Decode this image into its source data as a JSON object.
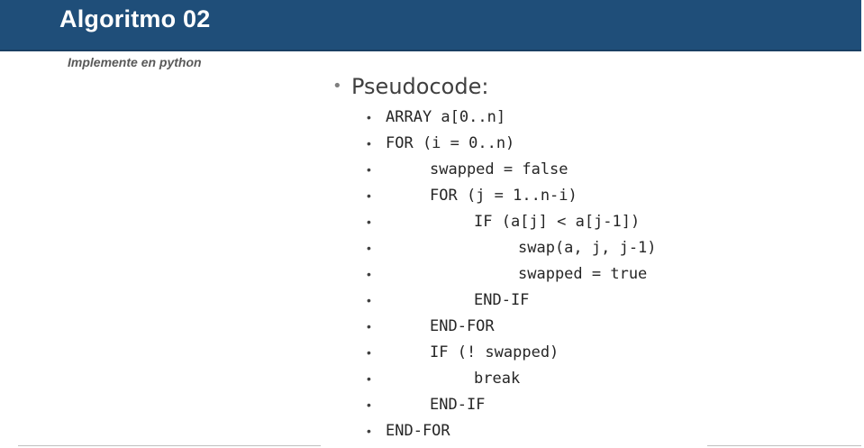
{
  "title": "Algoritmo 02",
  "subtitle": "Implemente en python",
  "pseudocode": {
    "heading": "Pseudocode:",
    "lines": [
      {
        "text": "ARRAY a[0..n]",
        "indent": 0
      },
      {
        "text": "FOR (i = 0..n)",
        "indent": 0
      },
      {
        "text": "swapped = false",
        "indent": 1
      },
      {
        "text": "FOR (j = 1..n-i)",
        "indent": 1
      },
      {
        "text": "IF (a[j] < a[j-1])",
        "indent": 2
      },
      {
        "text": "swap(a, j, j-1)",
        "indent": 3
      },
      {
        "text": "swapped = true",
        "indent": 3
      },
      {
        "text": "END-IF",
        "indent": 2
      },
      {
        "text": "END-FOR",
        "indent": 1
      },
      {
        "text": "IF (! swapped)",
        "indent": 1
      },
      {
        "text": "break",
        "indent": 2
      },
      {
        "text": "END-IF",
        "indent": 1
      },
      {
        "text": "END-FOR",
        "indent": 0
      }
    ]
  },
  "colors": {
    "title_bar": "#1f4e79",
    "title_text": "#ffffff",
    "subtitle_text": "#595959",
    "code_text": "#262626"
  }
}
